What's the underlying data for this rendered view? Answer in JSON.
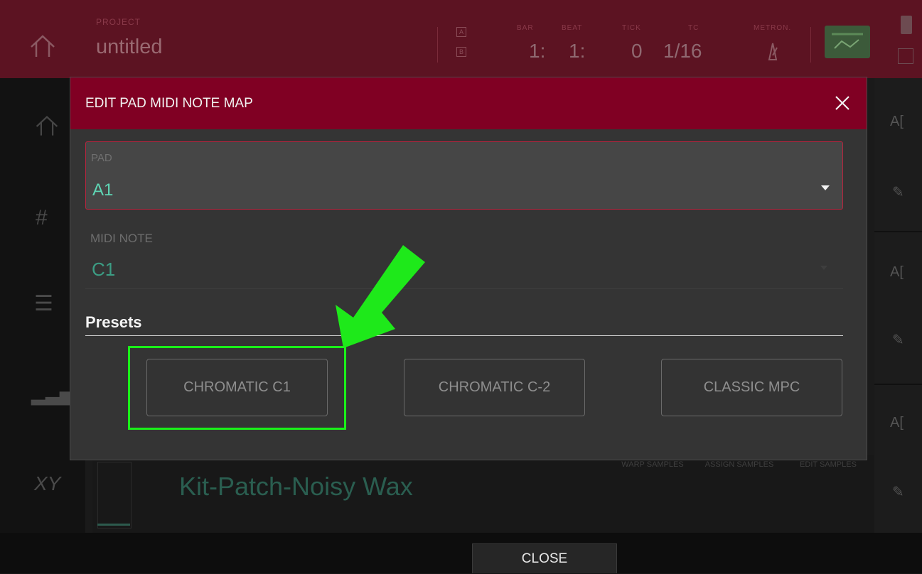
{
  "topbar": {
    "project_label": "PROJECT",
    "project_name": "untitled",
    "square_a": "A",
    "square_b": "B",
    "fields": [
      {
        "label": "BAR",
        "value": "1:"
      },
      {
        "label": "BEAT",
        "value": "1:"
      },
      {
        "label": "TICK",
        "value": "0"
      },
      {
        "label": "TC",
        "value": "1/16"
      },
      {
        "label": "METRON.",
        "value": ""
      }
    ]
  },
  "track": {
    "name": "Kit-Patch-Noisy Wax",
    "warp": "WARP SAMPLES",
    "assign": "ASSIGN SAMPLES",
    "edit": "EDIT SAMPLES"
  },
  "dialog": {
    "title": "EDIT PAD MIDI NOTE MAP",
    "pad_label": "PAD",
    "pad_value": "A1",
    "midi_label": "MIDI NOTE",
    "midi_value": "C1",
    "presets_title": "Presets",
    "presets": [
      "CHROMATIC C1",
      "CHROMATIC C-2",
      "CLASSIC MPC"
    ]
  },
  "bottom": {
    "close_label": "CLOSE"
  },
  "colors": {
    "header": "#800023",
    "accent_teal": "#5fd6b5",
    "annotation_green": "#1af019"
  }
}
